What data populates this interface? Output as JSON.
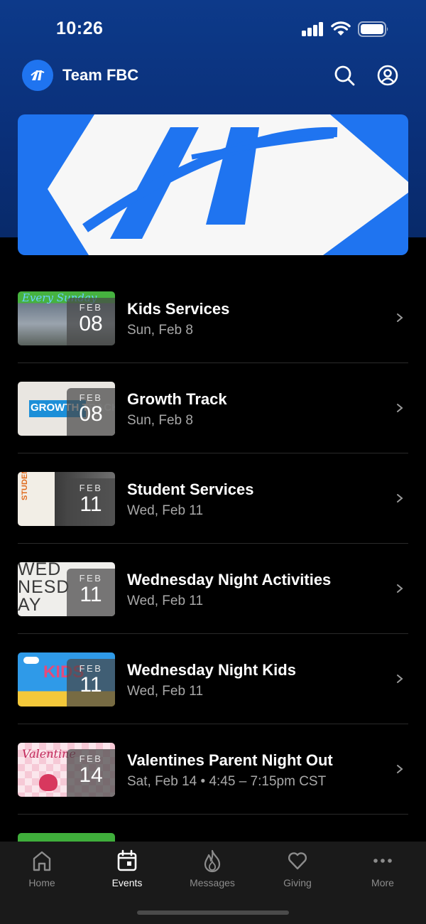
{
  "status_bar": {
    "time": "10:26"
  },
  "header": {
    "title": "Team FBC"
  },
  "events": [
    {
      "title": "Kids Services",
      "date": "Sun, Feb 8",
      "month": "FEB",
      "day": "08",
      "thumb_text": "Every Sunday"
    },
    {
      "title": "Growth Track",
      "date": "Sun, Feb 8",
      "month": "FEB",
      "day": "08",
      "thumb_text": "GROWTH TRACK"
    },
    {
      "title": "Student Services",
      "date": "Wed, Feb 11",
      "month": "FEB",
      "day": "11",
      "thumb_text": "STUDENTS"
    },
    {
      "title": "Wednesday Night Activities",
      "date": "Wed, Feb 11",
      "month": "FEB",
      "day": "11",
      "thumb_text": "WEDNESDAY"
    },
    {
      "title": "Wednesday Night Kids",
      "date": "Wed, Feb 11",
      "month": "FEB",
      "day": "11",
      "thumb_text": "KIDS"
    },
    {
      "title": "Valentines Parent Night Out",
      "date": "Sat, Feb 14 • 4:45 – 7:15pm CST",
      "month": "FEB",
      "day": "14",
      "thumb_text": "Valentine"
    }
  ],
  "tabs": [
    {
      "label": "Home",
      "icon": "home-icon",
      "active": false
    },
    {
      "label": "Events",
      "icon": "calendar-icon",
      "active": true
    },
    {
      "label": "Messages",
      "icon": "flame-icon",
      "active": false
    },
    {
      "label": "Giving",
      "icon": "heart-icon",
      "active": false
    },
    {
      "label": "More",
      "icon": "more-dots-icon",
      "active": false
    }
  ],
  "colors": {
    "brand_blue": "#1f74f0",
    "header_navy": "#0a2f78",
    "background": "#000000",
    "tab_bar": "#1a1a1a"
  }
}
